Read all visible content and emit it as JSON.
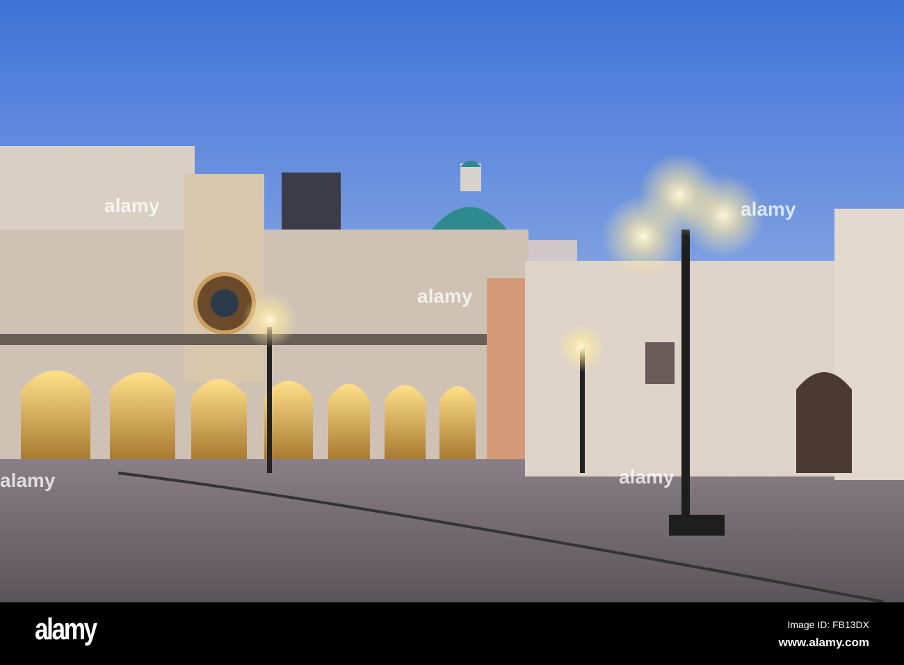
{
  "photo": {
    "subject": "Piazza della Loggia at dusk with clock tower, cathedral dome and street lamps",
    "colors": {
      "sky_top": "#3f72d8",
      "sky_bottom": "#a9c1ea",
      "facade": "#d8cfc4",
      "lamp_glow": "#fff3c8",
      "pavement": "#6e6a6f"
    }
  },
  "watermark": {
    "overlay_text": "alamy"
  },
  "footer": {
    "logo": "alamy",
    "image_id": "Image ID: FB13DX",
    "url": "www.alamy.com"
  }
}
